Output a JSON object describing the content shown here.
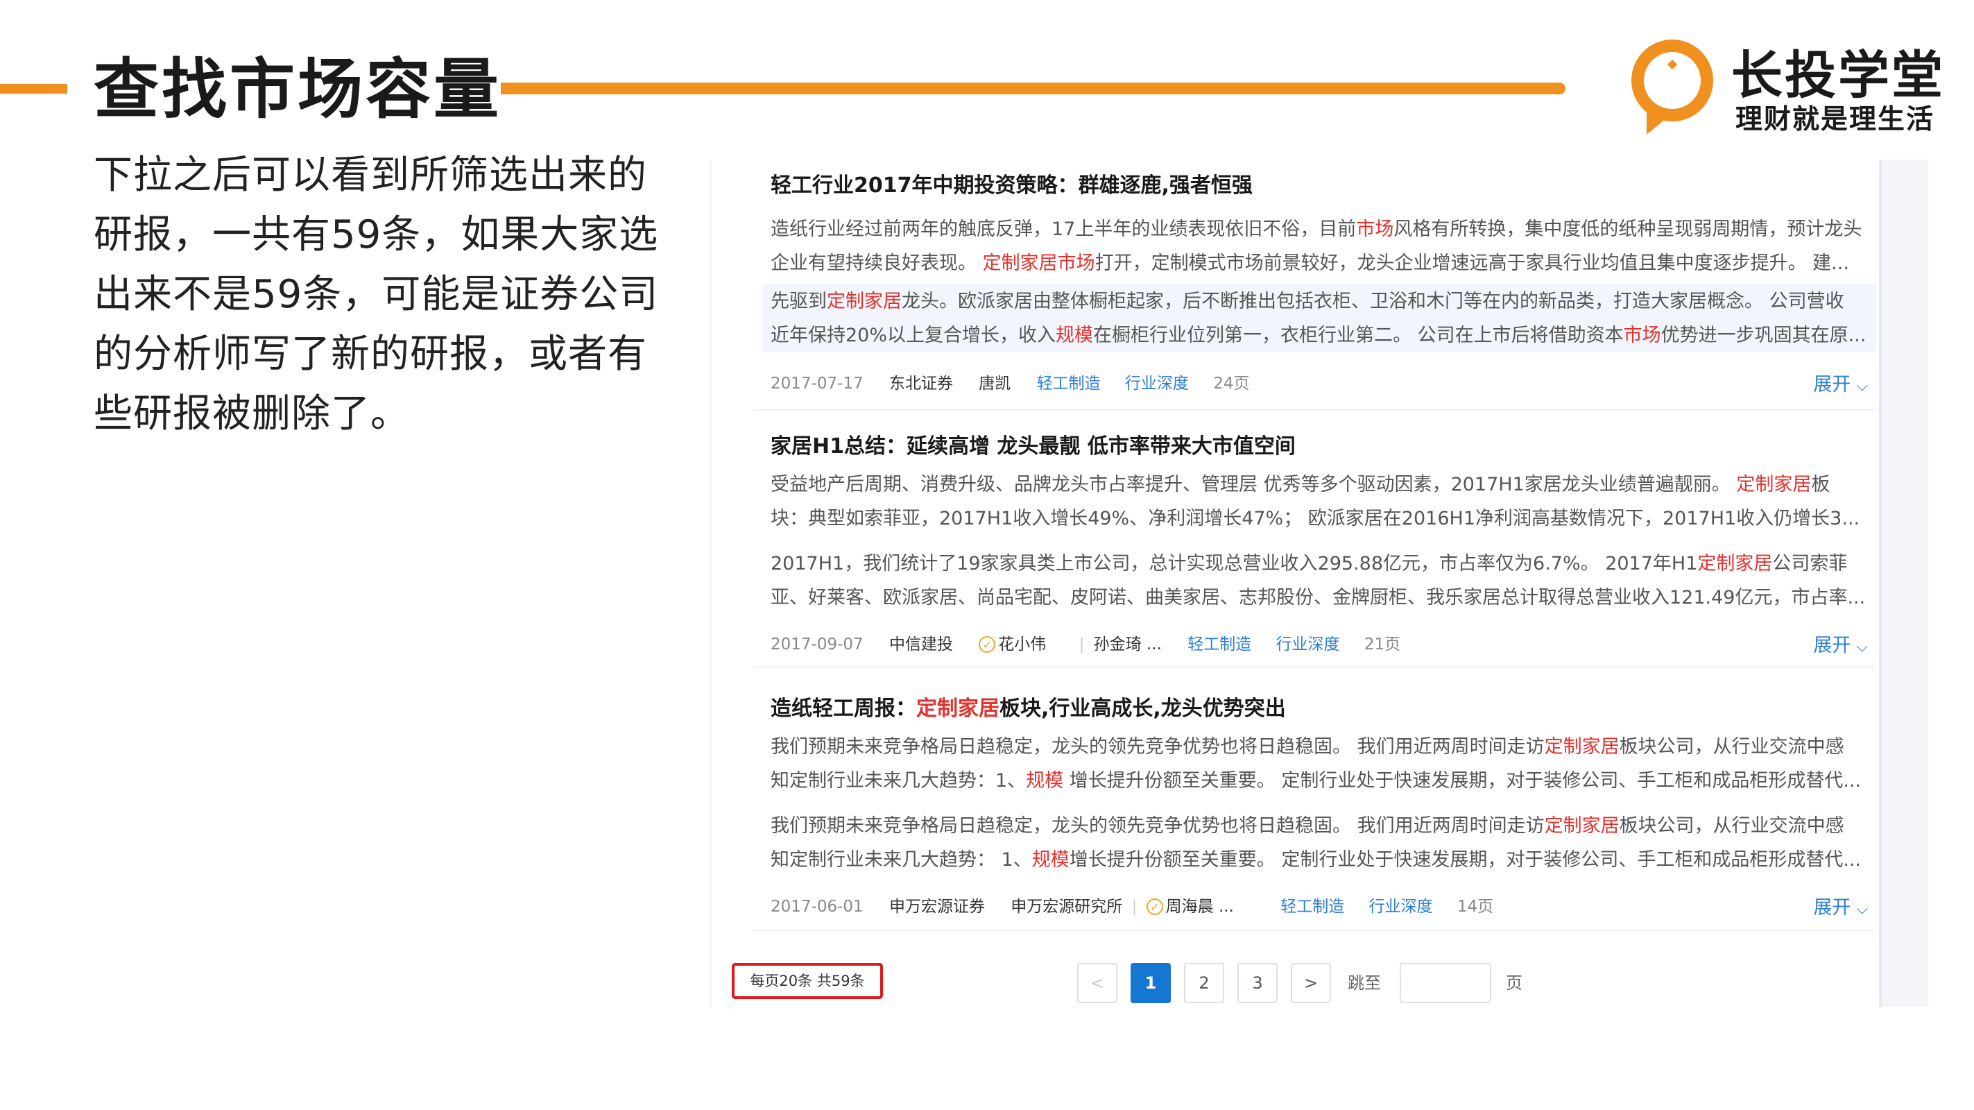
{
  "slide": {
    "title": "查找市场容量",
    "description": "下拉之后可以看到所筛选出来的研报，一共有59条，如果大家选出来不是59条，可能是证券公司的分析师写了新的研报，或者有些研报被删除了。"
  },
  "brand": {
    "name": "长投学堂",
    "slogan": "理财就是理生活",
    "accent_color": "#f0901e"
  },
  "reports": [
    {
      "title": "轻工行业2017年中期投资策略：群雄逐鹿,强者恒强",
      "para1_line1": [
        {
          "t": "造纸行业经过前两年的触底反弹，17上半年的业绩表现依旧不俗，目前",
          "h": false
        },
        {
          "t": "市场",
          "h": true
        },
        {
          "t": "风格有所转换，集中度低的纸种呈现弱周期情，预计龙头",
          "h": false
        }
      ],
      "para1_line2": [
        {
          "t": "企业有望持续良好表现。 ",
          "h": false
        },
        {
          "t": "定制家居市场",
          "h": true
        },
        {
          "t": "打开，定制模式市场前景较好，龙头企业增速远高于家具行业均值且集中度逐步提升。 建...",
          "h": false
        }
      ],
      "para2_line1": [
        {
          "t": "先驱到",
          "h": false
        },
        {
          "t": "定制家居",
          "h": true
        },
        {
          "t": "龙头。欧派家居由整体橱柜起家，后不断推出包括衣柜、卫浴和木门等在内的新品类，打造大家居概念。 公司营收",
          "h": false
        }
      ],
      "para2_line2": [
        {
          "t": "近年保持20%以上复合增长，收入",
          "h": false
        },
        {
          "t": "规模",
          "h": true
        },
        {
          "t": "在橱柜行业位列第一，衣柜行业第二。 公司在上市后将借助资本",
          "h": false
        },
        {
          "t": "市场",
          "h": true
        },
        {
          "t": "优势进一步巩固其在原...",
          "h": false
        }
      ],
      "date": "2017-07-17",
      "broker": "东北证券",
      "author": "唐凯",
      "tags": [
        "轻工制造",
        "行业深度"
      ],
      "pages": "24页",
      "expand_label": "展开"
    },
    {
      "title": "家居H1总结：延续高增 龙头最靓 低市率带来大市值空间",
      "para1_line1": [
        {
          "t": "受益地产后周期、消费升级、品牌龙头市占率提升、管理层 优秀等多个驱动因素，2017H1家居龙头业绩普遍靓丽。 ",
          "h": false
        },
        {
          "t": "定制家居",
          "h": true
        },
        {
          "t": "板",
          "h": false
        }
      ],
      "para1_line2": [
        {
          "t": "块：典型如索菲亚，2017H1收入增长49%、净利润增长47%； 欧派家居在2016H1净利润高基数情况下，2017H1收入仍增长3...",
          "h": false
        }
      ],
      "para2_line1": [
        {
          "t": "2017H1，我们统计了19家家具类上市公司，总计实现总营业收入295.88亿元，市占率仅为6.7%。 2017年H1",
          "h": false
        },
        {
          "t": "定制家居",
          "h": true
        },
        {
          "t": "公司索菲",
          "h": false
        }
      ],
      "para2_line2": [
        {
          "t": "亚、好莱客、欧派家居、尚品宅配、皮阿诺、曲美家居、志邦股份、金牌厨柜、我乐家居总计取得总营业收入121.49亿元，市占率...",
          "h": false
        }
      ],
      "date": "2017-09-07",
      "broker": "中信建投",
      "analyst1": "花小伟",
      "analyst2": "孙金琦 ...",
      "tags": [
        "轻工制造",
        "行业深度"
      ],
      "pages": "21页",
      "expand_label": "展开"
    },
    {
      "title_parts": [
        {
          "t": "造纸轻工周报：",
          "h": false
        },
        {
          "t": "定制家居",
          "h": true
        },
        {
          "t": "板块,行业高成长,龙头优势突出",
          "h": false
        }
      ],
      "para1_line1": [
        {
          "t": "我们预期未来竞争格局日趋稳定，龙头的领先竞争优势也将日趋稳固。 我们用近两周时间走访",
          "h": false
        },
        {
          "t": "定制家居",
          "h": true
        },
        {
          "t": "板块公司，从行业交流中感",
          "h": false
        }
      ],
      "para1_line2": [
        {
          "t": "知定制行业未来几大趋势：1、",
          "h": false
        },
        {
          "t": "规模",
          "h": true
        },
        {
          "t": " 增长提升份额至关重要。 定制行业处于快速发展期，对于装修公司、手工柜和成品柜形成替代...",
          "h": false
        }
      ],
      "para2_line1": [
        {
          "t": "我们预期未来竞争格局日趋稳定，龙头的领先竞争优势也将日趋稳固。 我们用近两周时间走访",
          "h": false
        },
        {
          "t": "定制家居",
          "h": true
        },
        {
          "t": "板块公司，从行业交流中感",
          "h": false
        }
      ],
      "para2_line2": [
        {
          "t": "知定制行业未来几大趋势： 1、",
          "h": false
        },
        {
          "t": "规模",
          "h": true
        },
        {
          "t": "增长提升份额至关重要。 定制行业处于快速发展期，对于装修公司、手工柜和成品柜形成替代...",
          "h": false
        }
      ],
      "date": "2017-06-01",
      "broker": "申万宏源证券",
      "institute": "申万宏源研究所",
      "analyst1": "周海晨 ...",
      "tags": [
        "轻工制造",
        "行业深度"
      ],
      "pages": "14页",
      "expand_label": "展开"
    }
  ],
  "pagination": {
    "summary": "每页20条 共59条",
    "prev": "<",
    "pages": [
      "1",
      "2",
      "3"
    ],
    "active_page": "1",
    "next": ">",
    "jump_label": "跳至",
    "jump_suffix": "页",
    "active_color": "#1677d2",
    "highlight_border_color": "#e0191b"
  },
  "icons": {
    "logo": "bulb-logo-icon",
    "badge": "verified-badge-icon",
    "expand": "chevron-down-icon"
  }
}
